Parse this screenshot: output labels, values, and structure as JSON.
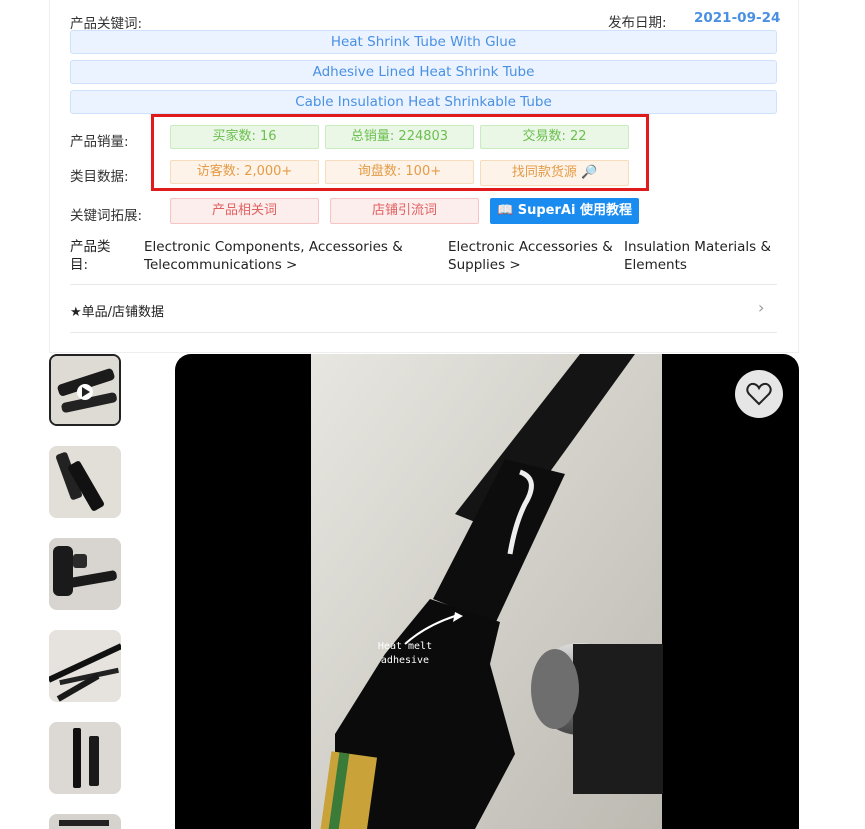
{
  "product": {
    "keywords_label": "产品关键词:",
    "publish_date_label": "发布日期:",
    "publish_date": "2021-09-24",
    "keywords": [
      "Heat Shrink Tube With Glue",
      "Adhesive Lined Heat Shrink Tube",
      "Cable Insulation Heat Shrinkable Tube"
    ],
    "sales_label": "产品销量:",
    "buyers": "买家数: 16",
    "total_sales": "总销量: 224803",
    "transactions": "交易数: 22",
    "category_data_label": "类目数据:",
    "visitors": "访客数: 2,000+",
    "inquiries": "询盘数: 100+",
    "find_similar": "找同款货源",
    "keyword_expand_label": "关键词拓展:",
    "related_words": "产品相关词",
    "traffic_words": "店铺引流词",
    "tutorial": "SuperAi 使用教程",
    "category_label": "产品类目:",
    "categories": [
      "Electronic Components, Accessories & Telecommunications >",
      "Electronic Accessories & Supplies >",
      "Insulation Materials & Elements"
    ],
    "shop_data": "单品/店铺数据"
  },
  "media": {
    "overlay_text": "Heat melt adhesive"
  },
  "colors": {
    "accent": "#4a90e2",
    "highlight": "#e11b1b",
    "button": "#1a8cf0"
  }
}
